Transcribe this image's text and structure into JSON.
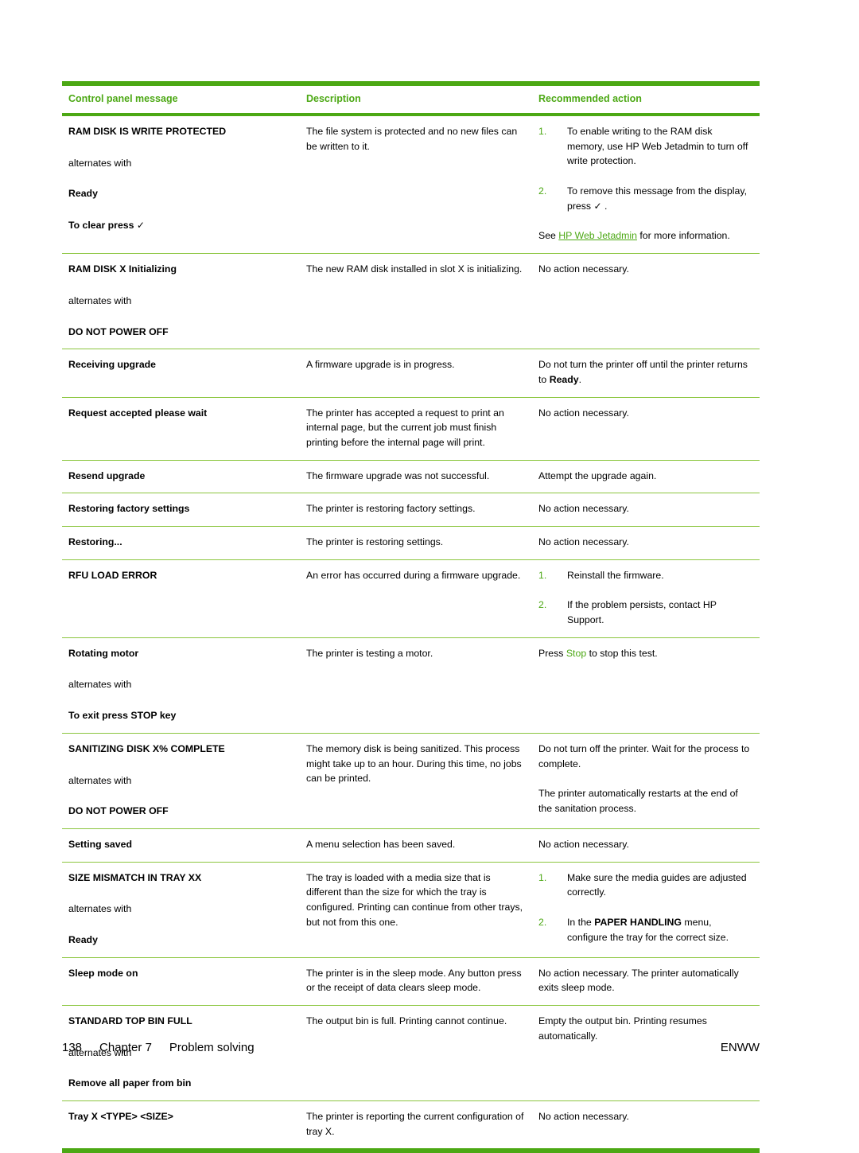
{
  "table": {
    "headers": [
      "Control panel message",
      "Description",
      "Recommended action"
    ],
    "accent_color": "#4ca814",
    "rule_color": "#8cc63f",
    "rows": [
      {
        "message_lines": [
          "RAM DISK IS WRITE PROTECTED",
          "alternates with",
          "Ready",
          "To clear press  ✓"
        ],
        "description": "The file system is protected and no new files can be written to it.",
        "steps": [
          "To enable writing to the RAM disk memory, use HP Web Jetadmin to turn off write protection.",
          "To remove this message from the display, press ✓ ."
        ],
        "after_steps_prefix": "See ",
        "after_steps_link": "HP Web Jetadmin",
        "after_steps_suffix": " for more information."
      },
      {
        "message_lines": [
          "RAM DISK X Initializing",
          "alternates with",
          "DO NOT POWER OFF"
        ],
        "description": "The new RAM disk installed in slot X is initializing.",
        "action": "No action necessary."
      },
      {
        "message_lines": [
          "Receiving upgrade"
        ],
        "description": "A firmware upgrade is in progress.",
        "action_prefix": "Do not turn the printer off until the printer returns to ",
        "action_bold": "Ready",
        "action_suffix": "."
      },
      {
        "message_lines": [
          "Request accepted please wait"
        ],
        "description": "The printer has accepted a request to print an internal page, but the current job must finish printing before the internal page will print.",
        "action": "No action necessary."
      },
      {
        "message_lines": [
          "Resend upgrade"
        ],
        "description": "The firmware upgrade was not successful.",
        "action": "Attempt the upgrade again."
      },
      {
        "message_lines": [
          "Restoring factory settings"
        ],
        "description": "The printer is restoring factory settings.",
        "action": "No action necessary."
      },
      {
        "message_lines": [
          "Restoring..."
        ],
        "description": "The printer is restoring settings.",
        "action": "No action necessary."
      },
      {
        "message_lines": [
          "RFU LOAD ERROR"
        ],
        "description": "An error has occurred during a firmware upgrade.",
        "steps": [
          "Reinstall the firmware.",
          "If the problem persists, contact HP Support."
        ]
      },
      {
        "message_lines": [
          "Rotating motor",
          "alternates with",
          "To exit press STOP key"
        ],
        "description": "The printer is testing a motor.",
        "action_prefix": "Press ",
        "action_green": "Stop",
        "action_suffix": " to stop this test."
      },
      {
        "message_lines": [
          "SANITIZING DISK X% COMPLETE",
          "alternates with",
          "DO NOT POWER OFF"
        ],
        "description": "The memory disk is being sanitized. This process might take up to an hour. During this time, no jobs can be printed.",
        "action_paras": [
          "Do not turn off the printer. Wait for the process to complete.",
          "The printer automatically restarts at the end of the sanitation process."
        ]
      },
      {
        "message_lines": [
          "Setting saved"
        ],
        "description": "A menu selection has been saved.",
        "action": "No action necessary."
      },
      {
        "message_lines": [
          "SIZE MISMATCH IN TRAY XX",
          "alternates with",
          "Ready"
        ],
        "description": "The tray is loaded with a media size that is different than the size for which the tray is configured. Printing can continue from other trays, but not from this one.",
        "steps_rich": [
          {
            "text": "Make sure the media guides are adjusted correctly."
          },
          {
            "prefix": "In the ",
            "bold": "PAPER HANDLING",
            "suffix": " menu, configure the tray for the correct size."
          }
        ]
      },
      {
        "message_lines": [
          "Sleep mode on"
        ],
        "description": "The printer is in the sleep mode. Any button press or the receipt of data clears sleep mode.",
        "action": "No action necessary. The printer automatically exits sleep mode."
      },
      {
        "message_lines": [
          "STANDARD TOP BIN FULL",
          "alternates with",
          "Remove all paper from bin"
        ],
        "description": "The output bin is full. Printing cannot continue.",
        "action": "Empty the output bin. Printing resumes automatically."
      },
      {
        "message_lines": [
          "Tray X <TYPE> <SIZE>"
        ],
        "description": "The printer is reporting the current configuration of tray X.",
        "action": "No action necessary."
      }
    ]
  },
  "footer": {
    "page_number": "138",
    "chapter": "Chapter 7",
    "section": "Problem solving",
    "edition": "ENWW"
  }
}
